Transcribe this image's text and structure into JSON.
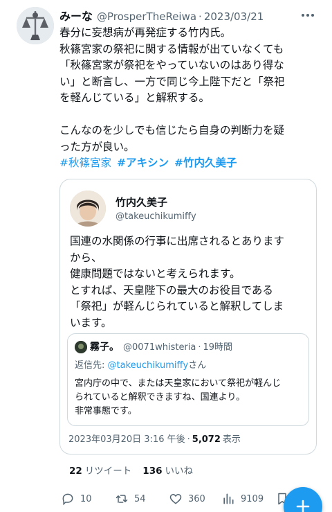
{
  "tweet": {
    "author_name": "みーな",
    "author_handle": "@ProsperTheReiwa",
    "separator": "·",
    "date": "2023/03/21",
    "body_lines": [
      "春分に妄想病が再発症する竹内氏。",
      "秋篠宮家の祭祀に関する情報が出ていなくても",
      "「秋篠宮家が祭祀をやっていないのはあり得な",
      "い」と断言し、一方で同じ今上陛下だと「祭祀",
      "を軽んじている」と解釈する。",
      "",
      "こんなのを少しでも信じたら自身の判断力を疑",
      "った方が良い。"
    ],
    "hashtags": [
      "#秋篠宮家",
      "#アキシン",
      "#竹内久美子"
    ]
  },
  "quote": {
    "author_name": "竹内久美子",
    "author_handle": "@takeuchikumiffy",
    "text_lines": [
      "国連の水関係の行事に出席されるとあります",
      "から、",
      "健康問題ではないと考えられます。",
      "とすれば、天皇陛下の最大のお役目である",
      "「祭祀」が軽んじられていると解釈してしま",
      "います。"
    ],
    "nested": {
      "author_name": "霧子。",
      "author_handle": "@0071whisteria",
      "separator": "·",
      "time": "19時間",
      "reply_prefix": "返信先: ",
      "reply_to": "@takeuchikumiffy",
      "reply_suffix": "さん",
      "text_lines": [
        "宮内庁の中で、または天皇家において祭祀が軽んじ",
        "られていると解釈できますね、国連より。",
        "非常事態です。"
      ]
    },
    "timestamp": "2023年03月20日 3:16 午後",
    "separator": "·",
    "views_count": "5,072",
    "views_label": "表示"
  },
  "stats": {
    "retweets_count": "22",
    "retweets_label": "リツイート",
    "likes_count": "136",
    "likes_label": "いいね"
  },
  "actions": {
    "reply_count": "10",
    "retweet_count": "54",
    "like_count": "360",
    "views_count": "9109"
  },
  "colors": {
    "accent": "#1d9bf0",
    "text": "#0f1419",
    "secondary": "#536471",
    "border": "#cfd9de"
  },
  "icons": [
    "more-icon",
    "reply-icon",
    "retweet-icon",
    "like-icon",
    "views-icon",
    "bookmark-icon",
    "share-icon",
    "compose-icon"
  ]
}
